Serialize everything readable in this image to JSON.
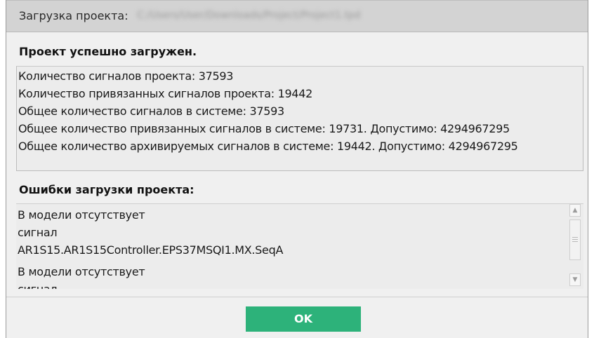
{
  "title": {
    "label": "Загрузка проекта:",
    "path": "C:/Users/User/Downloads/Project/Project1.tpd"
  },
  "success": {
    "heading": "Проект успешно загружен.",
    "lines": [
      "Количество сигналов проекта: 37593",
      "Количество привязанных сигналов проекта: 19442",
      "Общее количество сигналов в системе: 37593",
      "Общее количество привязанных сигналов в системе: 19731. Допустимо: 4294967295",
      "Общее количество архивируемых сигналов в системе: 19442. Допустимо: 4294967295"
    ]
  },
  "errors": {
    "heading": "Ошибки загрузки проекта:",
    "lines": [
      "В модели отсутствует",
      "сигнал",
      "AR1S15.AR1S15Controller.EPS37MSQI1.MX.SeqA",
      "В модели отсутствует",
      "сигнал"
    ]
  },
  "buttons": {
    "ok_label": "OK"
  },
  "colors": {
    "ok_button": "#2db27a",
    "titlebar": "#d3d3d3",
    "dialog_bg": "#f0f0f0"
  }
}
